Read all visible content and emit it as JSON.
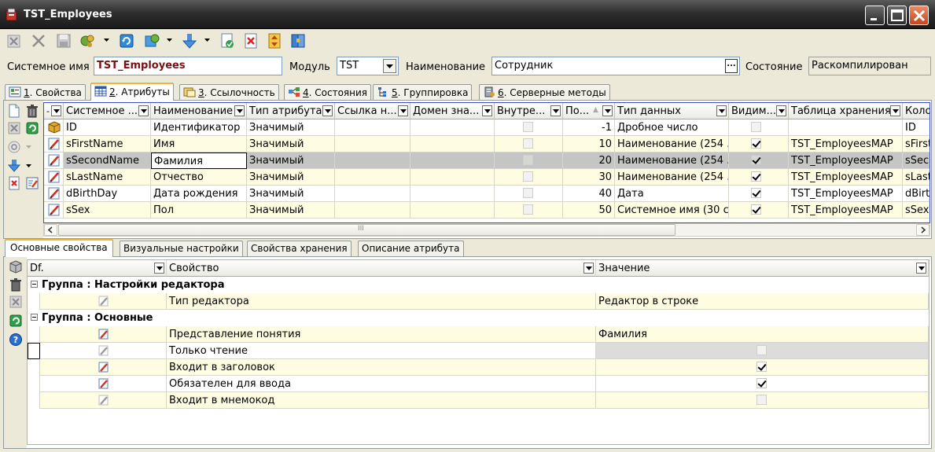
{
  "window": {
    "title": "TST_Employees"
  },
  "header": {
    "sysname_label": "Системное имя",
    "sysname_value": "TST_Employees",
    "module_label": "Модуль",
    "module_value": "TST",
    "name_label": "Наименование",
    "name_value": "Сотрудник",
    "state_label": "Состояние",
    "state_value": "Раскомпилирован"
  },
  "tabs": [
    {
      "num": "1",
      "label": ". Свойства"
    },
    {
      "num": "2",
      "label": ". Атрибуты"
    },
    {
      "num": "3",
      "label": ". Ссылочность"
    },
    {
      "num": "4",
      "label": ". Состояния"
    },
    {
      "num": "5",
      "label": ". Группировка"
    },
    {
      "num": "6",
      "label": ". Серверные методы"
    }
  ],
  "grid": {
    "columns": [
      "Системное ...",
      "Наименование",
      "Тип атрибута",
      "Ссылка н...",
      "Домен зна...",
      "Внутре...",
      "По...",
      "Тип данных",
      "Видим...",
      "Таблица хранения",
      "Коло"
    ],
    "rows": [
      {
        "sysname": "ID",
        "name": "Идентификатор",
        "attr_type": "Значимый",
        "order": "-1",
        "data_type": "Дробное число",
        "visible": false,
        "table": "",
        "column": "ID"
      },
      {
        "sysname": "sFirstName",
        "name": "Имя",
        "attr_type": "Значимый",
        "order": "10",
        "data_type": "Наименование (254 ...",
        "visible": true,
        "table": "TST_EmployeesMAP",
        "column": "sFirst"
      },
      {
        "sysname": "sSecondName",
        "name": "Фамилия",
        "attr_type": "Значимый",
        "order": "20",
        "data_type": "Наименование (254 ...",
        "visible": true,
        "table": "TST_EmployeesMAP",
        "column": "sSec"
      },
      {
        "sysname": "sLastName",
        "name": "Отчество",
        "attr_type": "Значимый",
        "order": "30",
        "data_type": "Наименование (254 ...",
        "visible": true,
        "table": "TST_EmployeesMAP",
        "column": "sLast"
      },
      {
        "sysname": "dBirthDay",
        "name": "Дата рождения",
        "attr_type": "Значимый",
        "order": "40",
        "data_type": "Дата",
        "visible": true,
        "table": "TST_EmployeesMAP",
        "column": "dBirth"
      },
      {
        "sysname": "sSex",
        "name": "Пол",
        "attr_type": "Значимый",
        "order": "50",
        "data_type": "Системное имя (30 с...",
        "visible": true,
        "table": "TST_EmployeesMAP",
        "column": "sSex"
      }
    ],
    "scroll_grip": "III"
  },
  "bottom_tabs": [
    "Основные свойства",
    "Визуальные настройки",
    "Свойства хранения",
    "Описание атрибута"
  ],
  "props": {
    "columns": [
      "Df.",
      "Свойство",
      "Значение"
    ],
    "groups": [
      {
        "title": "Группа : Настройки редактора",
        "items": [
          {
            "name": "Тип редактора",
            "value": "Редактор в строке"
          }
        ]
      },
      {
        "title": "Группа : Основные",
        "items": [
          {
            "name": "Представление понятия",
            "value": "Фамилия"
          },
          {
            "name": "Только чтение",
            "value": ""
          },
          {
            "name": "Входит в заголовок",
            "value": ""
          },
          {
            "name": "Обязателен для ввода",
            "value": ""
          },
          {
            "name": "Входит в мнемокод",
            "value": ""
          }
        ]
      }
    ]
  }
}
